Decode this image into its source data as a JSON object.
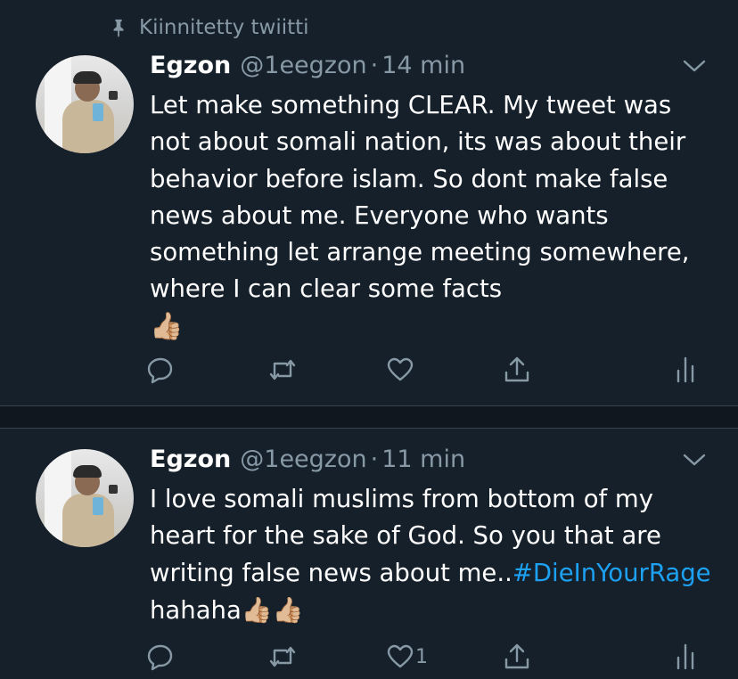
{
  "pinned": {
    "label": "Kiinnitetty twiitti"
  },
  "tweets": [
    {
      "name": "Egzon",
      "handle": "@1eegzon",
      "separator": "·",
      "time": "14 min",
      "text": "Let make something CLEAR. My tweet was not about somali nation, its was about their behavior before islam. So dont make false news about me. Everyone who wants something let arrange meeting somewhere, where I can clear some facts",
      "emoji": "👍🏼",
      "likes": ""
    },
    {
      "name": "Egzon",
      "handle": "@1eegzon",
      "separator": "·",
      "time": "11 min",
      "text_before": "I love somali muslims from bottom of my heart for the sake of God. So you that are writing false news about me..",
      "hashtag": "#DieInYourRage",
      "text_after": " hahaha",
      "emoji": "👍🏼👍🏼",
      "likes": "1"
    }
  ],
  "icons": {
    "pin": "pin-icon",
    "reply": "reply-icon",
    "retweet": "retweet-icon",
    "like": "heart-icon",
    "share": "share-icon",
    "analytics": "analytics-icon",
    "menu": "chevron-down-icon"
  },
  "colors": {
    "background": "#15202b",
    "muted": "#8899a6",
    "link": "#1da1f2"
  }
}
